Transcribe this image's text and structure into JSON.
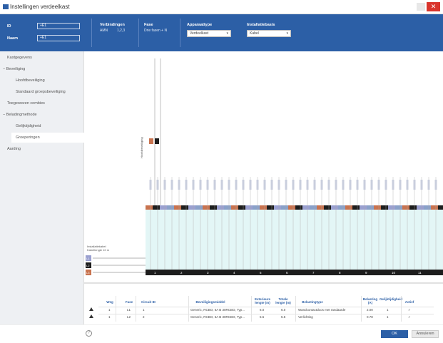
{
  "window": {
    "title": "Instellingen verdeelkast",
    "close_glyph": "✕"
  },
  "ribbon": {
    "id_label": "ID",
    "id_value": "+E1",
    "naam_label": "Naam",
    "naam_value": "+E1",
    "verbindingen_label": "Verbindingen",
    "verbindingen_key": "AMN",
    "verbindingen_value": "1,2,3",
    "fase_label": "Fase",
    "fase_value": "Drie fasen + N",
    "apparaattype_label": "Apparaattype",
    "apparaattype_value": "Verdeelkast",
    "installatiebasis_label": "Installatiebasis",
    "installatiebasis_value": "Kabel"
  },
  "sidebar": {
    "items": [
      {
        "label": "Kastgegevens"
      },
      {
        "label": "Beveiliging",
        "expand": "−"
      },
      {
        "label": "Hoofdbeveiliging"
      },
      {
        "label": "Standaard groepsbeveiliging"
      },
      {
        "label": "Toegewezen combies"
      },
      {
        "label": "Beladingmethode",
        "expand": "−"
      },
      {
        "label": "Gelijktijdigheid"
      },
      {
        "label": "Groeperingen"
      },
      {
        "label": "Aarding"
      }
    ]
  },
  "diagram": {
    "left_caption_1": "Installatiekabel",
    "left_caption_2": "Kabellengte 10 m",
    "left_boxes": [
      "L1",
      "L2",
      "L3"
    ],
    "main_column_label": "Hoofdbeveiliging",
    "group_labels": [
      "1",
      "2",
      "3",
      "4",
      "5",
      "6",
      "7",
      "8",
      "9",
      "10",
      "11"
    ],
    "phase_colors": {
      "L1": "#c8734f",
      "L2": "#1d1d1d",
      "L3": "#9aa0d0",
      "N": "#8aa1c9"
    },
    "grid_color": "#e3f6f6"
  },
  "table": {
    "headers": [
      "Weg",
      "Fase",
      "Circuit ID",
      "Beveiligingsmiddel",
      "Exterieure lengte (m)",
      "Totale lengte (m)",
      "Belastingtype",
      "Belasting (A)",
      "Gelijktijdigheid",
      "Actief"
    ],
    "rows": [
      [
        "1",
        "L1",
        "1",
        "Generic, RCBO, 6A B 30RCBO, Typ...",
        "6.0",
        "6.0",
        "Wandcontactdoos met randaarde",
        "2.00",
        "1",
        "✓"
      ],
      [
        "1",
        "L2",
        "2",
        "Generic, RCBO, 6A B 30RCBO, Typ...",
        "5.5",
        "5.5",
        "Verlichting",
        "0.78",
        "1",
        "✓"
      ]
    ]
  },
  "footer": {
    "help_glyph": "?",
    "ok_label": "OK",
    "cancel_label": "Annuleren"
  }
}
